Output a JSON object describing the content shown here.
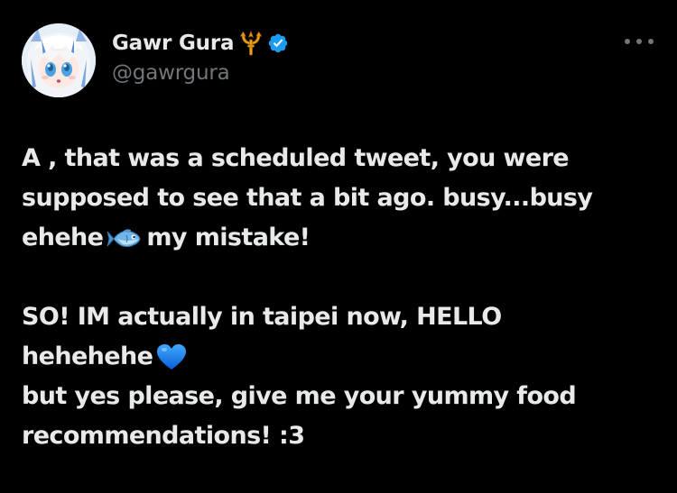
{
  "tweet": {
    "author": {
      "display_name": "Gawr Gura",
      "handle": "@gawrgura",
      "name_emoji_icon": "trident-icon",
      "verified_icon": "verified-badge-icon",
      "verified_color": "#1d9bf0"
    },
    "more_icon": "more-options-icon",
    "body": {
      "line1": "A , that was a scheduled tweet, you were",
      "line2": "supposed to see that a bit ago. busy...busy",
      "line3_start": "ehehe",
      "line3_emoji": "fish-icon",
      "line3_end": "my mistake!",
      "line4": "SO! IM actually in taipei now, HELLO",
      "line5_start": "hehehehe",
      "line5_emoji": "blue-heart-icon",
      "line6": "but yes please, give me your yummy food",
      "line7": "recommendations! :3"
    }
  },
  "colors": {
    "background": "#000000",
    "text": "#e7e9ea",
    "secondary_text": "#71767b",
    "accent": "#1d9bf0"
  }
}
